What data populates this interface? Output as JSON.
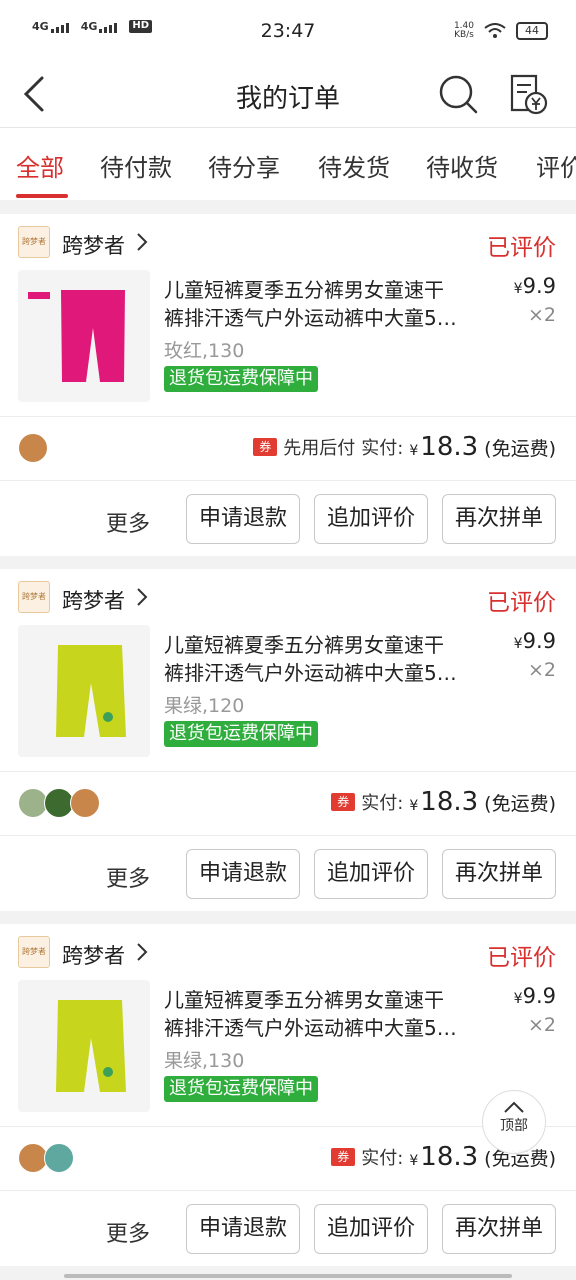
{
  "status_bar": {
    "network_1": "4G",
    "network_2": "4G",
    "hd": "HD",
    "time": "23:47",
    "speed_value": "1.40",
    "speed_unit": "KB/s",
    "battery": "44"
  },
  "header": {
    "title": "我的订单"
  },
  "tabs": [
    {
      "label": "全部"
    },
    {
      "label": "待付款"
    },
    {
      "label": "待分享"
    },
    {
      "label": "待发货"
    },
    {
      "label": "待收货"
    },
    {
      "label": "评价"
    }
  ],
  "orders": [
    {
      "shop_logo": "跨梦者",
      "shop_name": "跨梦者",
      "status": "已评价",
      "title_line1": "儿童短裤夏季五分裤男女童速干",
      "title_line2": "裤排汗透气户外运动裤中大童5…",
      "sku": "玫红,130",
      "guarantee": "退货包运费保障中",
      "price_symbol": "¥",
      "price": "9.9",
      "quantity": "×2",
      "pay_method": "先用后付",
      "coupon": "券",
      "paid_label": "实付:",
      "currency": "¥",
      "paid_amount": "18.3",
      "freight": "(免运费)",
      "product_color": "#e0187a"
    },
    {
      "shop_logo": "跨梦者",
      "shop_name": "跨梦者",
      "status": "已评价",
      "title_line1": "儿童短裤夏季五分裤男女童速干",
      "title_line2": "裤排汗透气户外运动裤中大童5…",
      "sku": "果绿,120",
      "guarantee": "退货包运费保障中",
      "price_symbol": "¥",
      "price": "9.9",
      "quantity": "×2",
      "pay_method": "",
      "coupon": "券",
      "paid_label": "实付:",
      "currency": "¥",
      "paid_amount": "18.3",
      "freight": "(免运费)",
      "product_color": "#c7d61c"
    },
    {
      "shop_logo": "跨梦者",
      "shop_name": "跨梦者",
      "status": "已评价",
      "title_line1": "儿童短裤夏季五分裤男女童速干",
      "title_line2": "裤排汗透气户外运动裤中大童5…",
      "sku": "果绿,130",
      "guarantee": "退货包运费保障中",
      "price_symbol": "¥",
      "price": "9.9",
      "quantity": "×2",
      "pay_method": "",
      "coupon": "券",
      "paid_label": "实付:",
      "currency": "¥",
      "paid_amount": "18.3",
      "freight": "(免运费)",
      "product_color": "#c7d61c"
    }
  ],
  "actions": {
    "more": "更多",
    "refund": "申请退款",
    "add_review": "追加评价",
    "rebuy": "再次拼单"
  },
  "back_to_top": "顶部",
  "colors": {
    "accent": "#d8302f",
    "guarantee_green": "#2fae3d"
  }
}
